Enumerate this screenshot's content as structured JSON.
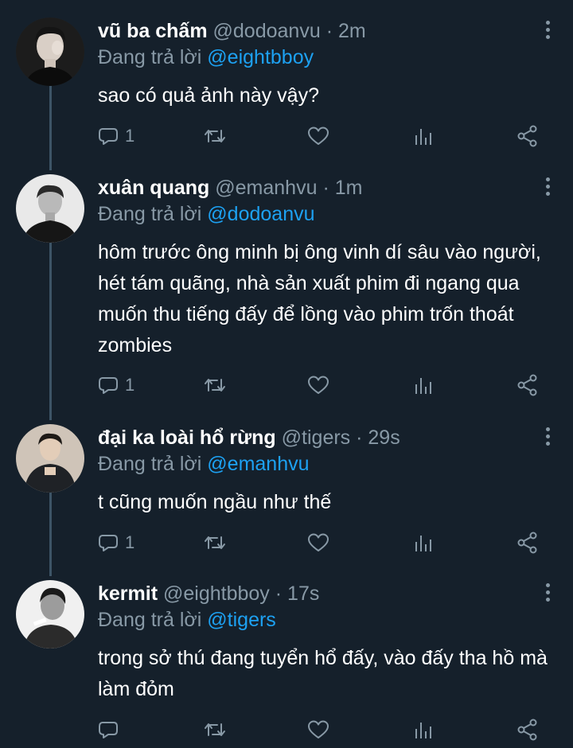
{
  "reply_prefix": "Đang trả lời",
  "tweets": [
    {
      "name": "vũ ba chấm",
      "handle": "@dodoanvu",
      "time": "2m",
      "reply_to": "@eightbboy",
      "text": "sao có quả ảnh này vậy?",
      "reply_count": "1",
      "avatar_icon": "avatar-man-dark-hair"
    },
    {
      "name": "xuân quang",
      "handle": "@emanhvu",
      "time": "1m",
      "reply_to": "@dodoanvu",
      "text": "hôm trước ông minh bị ông vinh dí sâu vào người, hét tám quãng, nhà sản xuất phim đi ngang qua muốn thu tiếng đấy để lồng vào phim trốn thoát zombies",
      "reply_count": "1",
      "avatar_icon": "avatar-man-bw-portrait"
    },
    {
      "name": "đại ka loài hổ rừng",
      "handle": "@tigers",
      "time": "29s",
      "reply_to": "@emanhvu",
      "text": "t cũng muốn ngầu như thế",
      "reply_count": "1",
      "avatar_icon": "avatar-man-suit"
    },
    {
      "name": "kermit",
      "handle": "@eightbboy",
      "time": "17s",
      "reply_to": "@tigers",
      "text": "trong sở thú đang tuyển hổ đấy, vào đấy tha hồ mà làm đỏm",
      "reply_count": "",
      "avatar_icon": "avatar-man-bw-smoking"
    }
  ],
  "icons": {
    "more": "more-vertical-icon",
    "reply": "reply-icon",
    "retweet": "retweet-icon",
    "like": "heart-icon",
    "analytics": "analytics-icon",
    "share": "share-icon"
  },
  "colors": {
    "background": "#15202b",
    "secondary_text": "#8899a6",
    "link": "#1da1f2",
    "thread_line": "#3d5466"
  }
}
